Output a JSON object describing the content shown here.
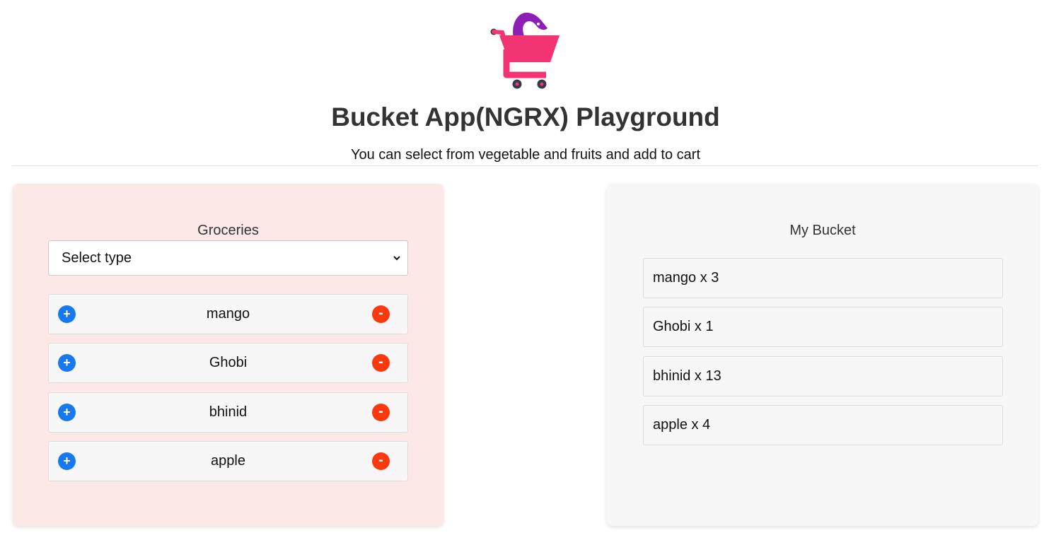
{
  "app": {
    "title": "Bucket App(NGRX) Playground",
    "subtitle": "You can select from vegetable and fruits and add to cart",
    "logo_icon": "shopping-cart-logo-icon"
  },
  "groceries": {
    "title": "Groceries",
    "select": {
      "selected": "Select type"
    },
    "add_label": "+",
    "remove_label": "-",
    "items": [
      {
        "name": "mango"
      },
      {
        "name": "Ghobi"
      },
      {
        "name": "bhinid"
      },
      {
        "name": "apple"
      }
    ]
  },
  "bucket": {
    "title": "My Bucket",
    "items": [
      {
        "text": "mango x 3"
      },
      {
        "text": "Ghobi x 1"
      },
      {
        "text": "bhinid x 13"
      },
      {
        "text": "apple x 4"
      }
    ]
  },
  "colors": {
    "add_button": "#1778ef",
    "remove_button": "#fa3a0e",
    "groceries_panel_bg": "#fde8e8",
    "bucket_panel_bg": "#f7f7f7",
    "logo_cart": "#f23473",
    "logo_snake": "#8e1fb5"
  }
}
